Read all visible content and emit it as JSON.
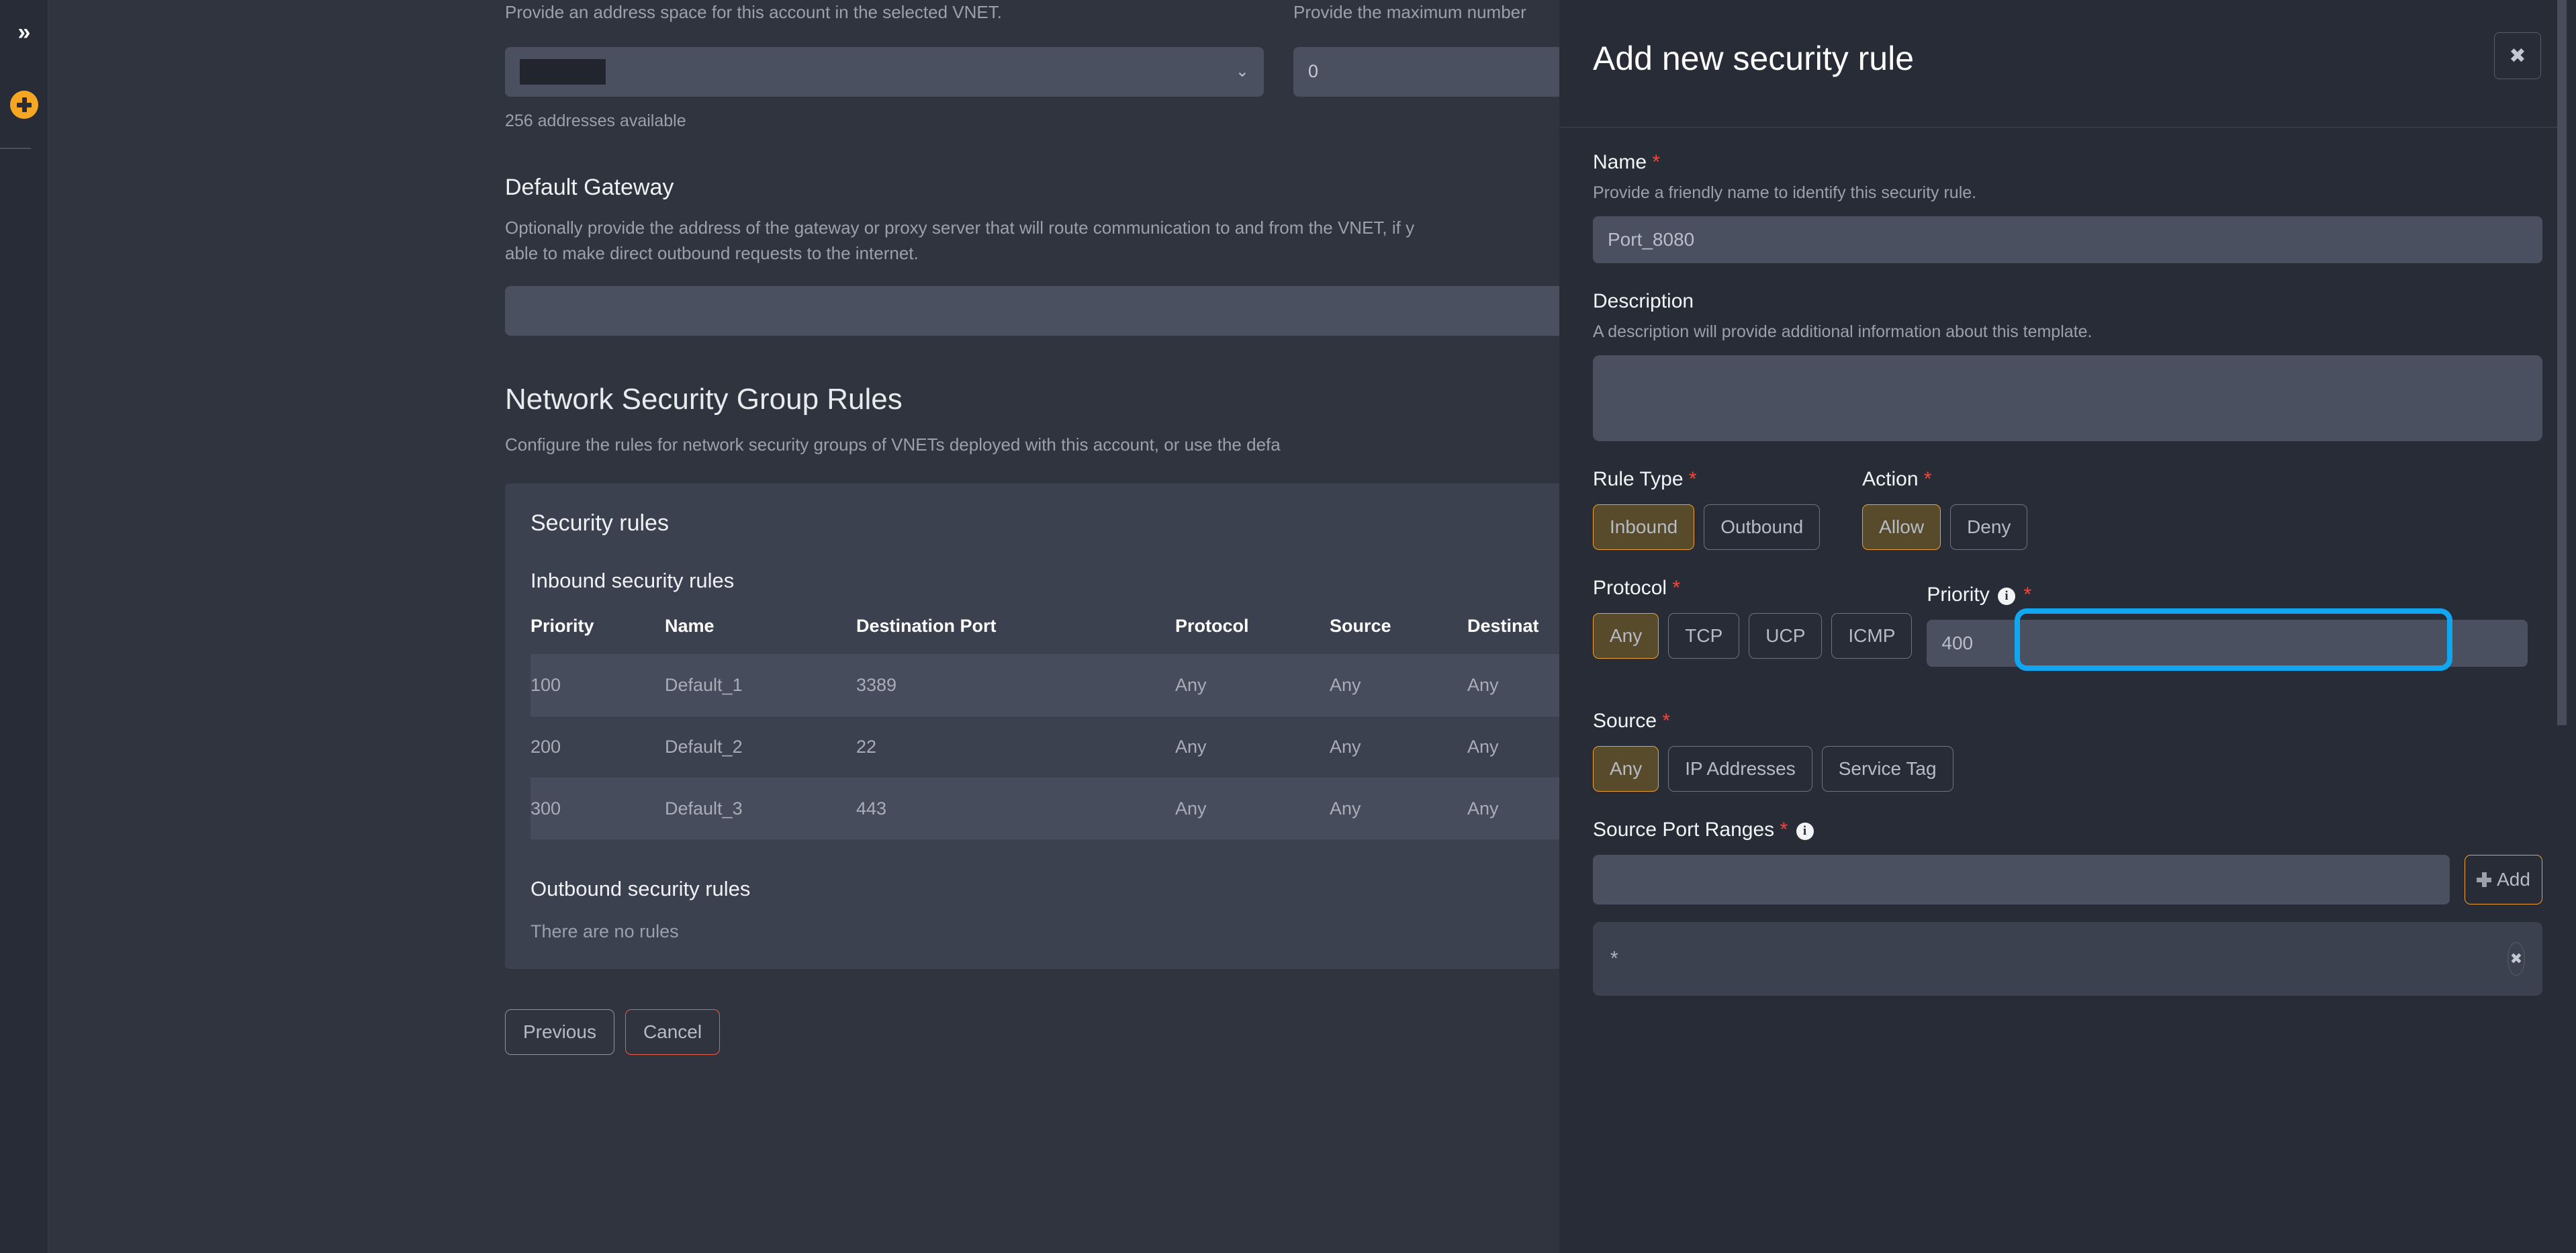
{
  "rail": {
    "expand_icon": "»",
    "add_icon": "plus-circle",
    "accent": "#f5a623"
  },
  "main": {
    "address_space": {
      "help": "Provide an address space for this account in the selected VNET.",
      "value": "",
      "value_redacted": true,
      "caret": "⌄",
      "note": "256 addresses available"
    },
    "max_number": {
      "help": "Provide the maximum number",
      "value": "0"
    },
    "default_gateway": {
      "title": "Default Gateway",
      "help": "Optionally provide the address of the gateway or proxy server that will route communication to and from the VNET, if y\nable to make direct outbound requests to the internet.",
      "help_line1": "Optionally provide the address of the gateway or proxy server that will route communication to and from the VNET, if y",
      "help_line2": "able to make direct outbound requests to the internet.",
      "value": ""
    },
    "nsg": {
      "title": "Network Security Group Rules",
      "help": "Configure the rules for network security groups of VNETs deployed with this account, or use the defa",
      "card_title": "Security rules",
      "inbound_title": "Inbound security rules",
      "columns": [
        "Priority",
        "Name",
        "Destination Port",
        "Protocol",
        "Source",
        "Destinat"
      ],
      "rows": [
        {
          "priority": "100",
          "name": "Default_1",
          "destination_port": "3389",
          "protocol": "Any",
          "source": "Any",
          "destination": "Any"
        },
        {
          "priority": "200",
          "name": "Default_2",
          "destination_port": "22",
          "protocol": "Any",
          "source": "Any",
          "destination": "Any"
        },
        {
          "priority": "300",
          "name": "Default_3",
          "destination_port": "443",
          "protocol": "Any",
          "source": "Any",
          "destination": "Any"
        }
      ],
      "outbound_title": "Outbound security rules",
      "outbound_empty": "There are no rules"
    },
    "footer": {
      "previous_label": "Previous",
      "cancel_label": "Cancel",
      "cancel_color": "#e8604c"
    }
  },
  "panel": {
    "title": "Add new security rule",
    "close_icon": "✖",
    "name": {
      "label": "Name",
      "required": "*",
      "help": "Provide a friendly name to identify this security rule.",
      "value": "Port_8080"
    },
    "description": {
      "label": "Description",
      "help": "A description will provide additional information about this template.",
      "value": ""
    },
    "rule_type": {
      "label": "Rule Type",
      "required": "*",
      "options": [
        "Inbound",
        "Outbound"
      ],
      "selected": "Inbound"
    },
    "action": {
      "label": "Action",
      "required": "*",
      "options": [
        "Allow",
        "Deny"
      ],
      "selected": "Allow"
    },
    "protocol": {
      "label": "Protocol",
      "required": "*",
      "options": [
        "Any",
        "TCP",
        "UCP",
        "ICMP"
      ],
      "selected": "Any"
    },
    "priority": {
      "label": "Priority",
      "required": "*",
      "info_icon": "i",
      "value": "400",
      "highlight_color": "#11a7f0",
      "highlighted": true
    },
    "source": {
      "label": "Source",
      "required": "*",
      "options": [
        "Any",
        "IP Addresses",
        "Service Tag"
      ],
      "selected": "Any"
    },
    "source_port_ranges": {
      "label": "Source Port Ranges",
      "required": "*",
      "info_icon": "i",
      "value": "",
      "add_label": "Add",
      "chips": [
        {
          "value": "*",
          "remove_icon": "✖"
        }
      ]
    }
  }
}
